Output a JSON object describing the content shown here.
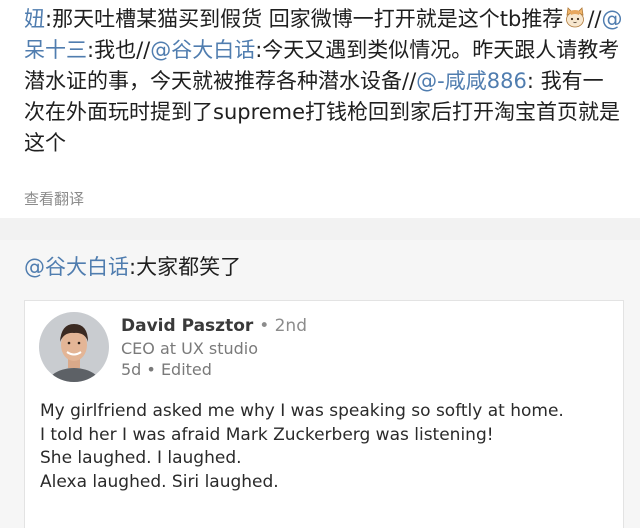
{
  "post": {
    "author": "妞",
    "text_1": ":那天吐槽某猫买到假货 回家微博一打开就是这个tb推荐",
    "emoji": "cat-face-icon",
    "sep_1": "//",
    "mention_1": "@呆十三",
    "text_2": ":我也//",
    "mention_2": "@谷大白话",
    "text_3": ":今天又遇到类似情况。昨天跟人请教考潜水证的事，今天就被推荐各种潜水设备//",
    "mention_3": "@-咸咸886",
    "text_4": ": 我有一次在外面玩时提到了supreme打钱枪回到家后打开淘宝首页就是这个",
    "translate": "查看翻译"
  },
  "repost": {
    "mention": "@谷大白话",
    "text": ":大家都笑了"
  },
  "card": {
    "name": "David Pasztor",
    "degree": "• 2nd",
    "title": "CEO at UX studio",
    "meta": "5d • Edited",
    "lines": [
      "My girlfriend asked me why I was speaking so softly at home.",
      "I told her I was afraid Mark Zuckerberg was listening!",
      "She laughed. I laughed.",
      "Alexa laughed. Siri laughed."
    ]
  },
  "colors": {
    "mention": "#507daf",
    "text": "#1f1f1f",
    "muted": "#8b8b8b",
    "repost_bg": "#f6f6f6"
  }
}
